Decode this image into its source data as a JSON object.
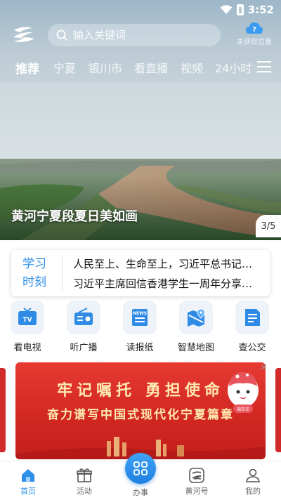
{
  "status_bar": {
    "time": "3:52"
  },
  "header": {
    "search_placeholder": "输入关键词",
    "location_text": "未获取位置",
    "location_badge": "?",
    "tabs": [
      "推荐",
      "宁夏",
      "银川市",
      "看直播",
      "视频",
      "24小时"
    ],
    "active_tab": "推荐"
  },
  "hero": {
    "caption": "黄河宁夏段夏日美如画",
    "counter": "3/5"
  },
  "study": {
    "label_line1": "学习",
    "label_line2": "时刻",
    "news": [
      "人民至上、生命至上，习近平总书记…",
      "习近平主席回信香港学生一周年分享…"
    ]
  },
  "services": [
    {
      "label": "看电视",
      "icon": "tv-icon"
    },
    {
      "label": "听广播",
      "icon": "radio-icon"
    },
    {
      "label": "读报纸",
      "icon": "newspaper-icon"
    },
    {
      "label": "智慧地图",
      "icon": "map-icon"
    },
    {
      "label": "查公交",
      "icon": "bus-icon"
    }
  ],
  "banner": {
    "line1": "牢记嘱托 勇担使命",
    "line2": "奋力谱写中国式现代化宁夏篇章",
    "mascot_text": "福莎莎",
    "close": "×"
  },
  "bottom_nav": [
    {
      "label": "首页",
      "icon": "home-icon"
    },
    {
      "label": "活动",
      "icon": "gift-icon"
    },
    {
      "label": "办事",
      "icon": "grid-icon"
    },
    {
      "label": "黄河号",
      "icon": "huanghe-icon"
    },
    {
      "label": "我的",
      "icon": "user-icon"
    }
  ],
  "colors": {
    "accent": "#2d8fe8",
    "banner_red": "#d42924",
    "banner_text": "#ffe9b0"
  }
}
